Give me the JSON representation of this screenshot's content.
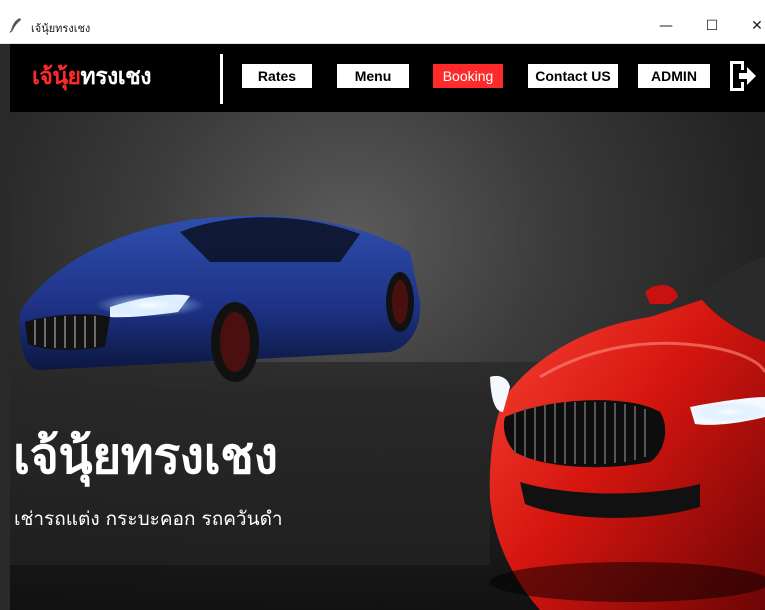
{
  "window": {
    "title": "เจ้นุ้ยทรงเชง",
    "minimize_glyph": "—",
    "maximize_glyph": "☐",
    "close_glyph": "✕"
  },
  "navbar": {
    "brand_part_a": "เจ้นุ้ย",
    "brand_part_b": "ทรงเชง",
    "buttons": [
      {
        "label": "Rates"
      },
      {
        "label": "Menu"
      },
      {
        "label": "Booking"
      },
      {
        "label": "Contact US"
      },
      {
        "label": "ADMIN"
      }
    ],
    "active_button": "Booking",
    "logout_icon": "logout-icon"
  },
  "hero": {
    "title": "เจ้นุ้ยทรงเชง",
    "subtitle": "เช่ารถแต่ง กระบะคอก รถควันดำ"
  },
  "colors": {
    "accent": "#ff2b2b",
    "navbar_bg": "#000000",
    "button_bg": "#ffffff"
  }
}
